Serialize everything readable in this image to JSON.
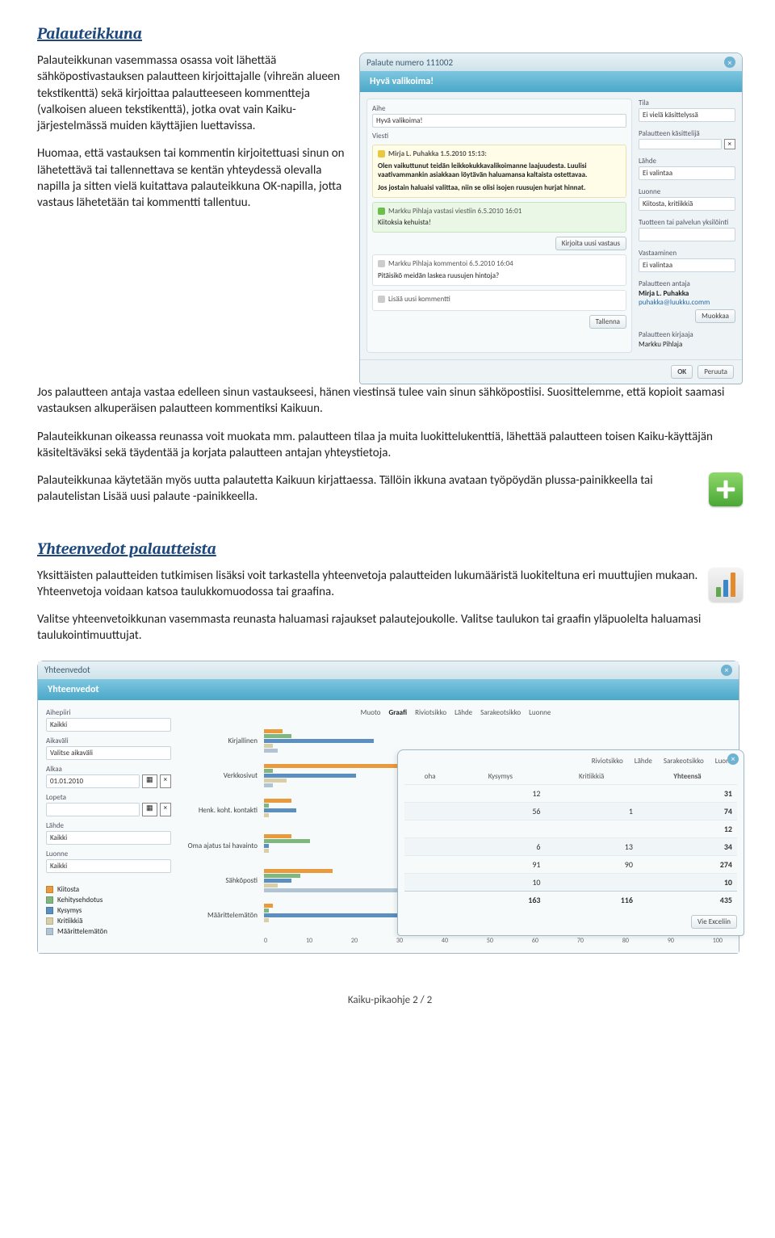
{
  "doc": {
    "h1": "Palauteikkuna",
    "p1": "Palauteikkunan vasemmassa osassa voit lähettää sähköpostivastauksen palautteen kirjoittajalle (vihreän alueen tekstikenttä) sekä kirjoittaa palautteeseen kommentteja (valkoisen alueen tekstikenttä), jotka ovat vain Kaiku-järjestelmässä muiden käyttäjien luettavissa.",
    "p2": "Huomaa, että vastauksen tai kommentin kirjoitettuasi sinun on lähetettävä tai tallennettava se kentän yhteydessä olevalla napilla ja sitten vielä kuitattava palauteikkuna OK-napilla, jotta vastaus lähetetään tai kommentti tallentuu.",
    "p3": "Jos palautteen antaja vastaa edelleen sinun vastaukseesi, hänen viestinsä tulee vain sinun sähköpostiisi. Suosittelemme, että kopioit saamasi vastauksen alkuperäisen palautteen kommentiksi Kaikuun.",
    "p4": "Palauteikkunan oikeassa reunassa voit muokata mm. palautteen tilaa ja muita luokittelukenttiä, lähettää palautteen toisen Kaiku-käyttäjän käsiteltäväksi sekä täydentää ja korjata palautteen antajan yhteystietoja.",
    "p5": "Palauteikkunaa käytetään myös uutta palautetta Kaikuun kirjattaessa. Tällöin ikkuna avataan työpöydän plussa-painikkeella tai palautelistan Lisää uusi palaute -painikkeella.",
    "h2": "Yhteenvedot palautteista",
    "p6": "Yksittäisten palautteiden tutkimisen lisäksi voit tarkastella yhteenvetoja palautteiden lukumääristä luokiteltuna eri muuttujien mukaan. Yhteenvetoja voidaan katsoa taulukkomuodossa tai graafina.",
    "p7": "Valitse yhteenvetoikkunan vasemmasta reunasta haluamasi rajaukset palautejoukolle. Valitse taulukon tai graafin yläpuolelta haluamasi taulukointimuuttujat.",
    "footer": "Kaiku-pikaohje 2 / 2"
  },
  "dlg1": {
    "title": "Palaute numero 111002",
    "tab": "Hyvä valikoima!",
    "aihe_label": "Aihe",
    "aihe_value": "Hyvä valikoima!",
    "viesti_label": "Viesti",
    "msg1_head": "Mirja L. Puhakka 1.5.2010 15:13:",
    "msg1_body": "Olen vaikuttunut teidän leikkokukkavalikoimanne laajuudesta. Luulisi vaativammankin asiakkaan löytävän haluamansa kaltaista ostettavaa.",
    "msg1_body2": "Jos jostain haluaisi valittaa, niin se olisi isojen ruusujen hurjat hinnat.",
    "msg2_head": "Markku Pihlaja vastasi viestiin 6.5.2010 16:01",
    "msg2_body": "Kiitoksia kehuista!",
    "btn_new_reply": "Kirjoita uusi vastaus",
    "msg3_head": "Markku Pihlaja kommentoi 6.5.2010 16:04",
    "msg3_body": "Pitäisikö meidän laskea ruusujen hintoja?",
    "btn_new_comment": "Lisää uusi kommentti",
    "btn_tallenna": "Tallenna",
    "btn_ok": "OK",
    "btn_peruuta": "Peruuta",
    "side": {
      "tila_l": "Tila",
      "tila_v": "Ei vielä käsittelyssä",
      "kasittelija_l": "Palautteen käsittelijä",
      "lahde_l": "Lähde",
      "lahde_v": "Ei valintaa",
      "luonne_l": "Luonne",
      "luonne_v": "Kiitosta, kritiikkiä",
      "tuotteen_l": "Tuotteen tai palvelun yksilöinti",
      "vastaaminen_l": "Vastaaminen",
      "vastaaminen_v": "Ei valintaa",
      "antaja_l": "Palautteen antaja",
      "antaja_name": "Mirja L. Puhakka",
      "antaja_email": "puhakka@luukku.comm",
      "btn_muokkaa": "Muokkaa",
      "kirjaaja_l": "Palautteen kirjaaja",
      "kirjaaja_v": "Markku Pihlaja"
    }
  },
  "dlg2": {
    "title": "Yhteenvedot",
    "tab": "Yhteenvedot",
    "left": {
      "aihepiiri_l": "Aihepiiri",
      "aihepiiri_v": "Kaikki",
      "aikavali_l": "Aikaväli",
      "aikavali_v": "Valitse aikaväli",
      "alkaa_l": "Alkaa",
      "alkaa_v": "01.01.2010",
      "lopeta_l": "Lopeta",
      "lahde_l": "Lähde",
      "lahde_v": "Kaikki",
      "luonne_l": "Luonne",
      "luonne_v": "Kaikki"
    },
    "legend": [
      {
        "label": "Kiitosta",
        "color": "#e89a3c"
      },
      {
        "label": "Kehitysehdotus",
        "color": "#7fb77e"
      },
      {
        "label": "Kysymys",
        "color": "#5a8fbf"
      },
      {
        "label": "Kritiikkiä",
        "color": "#d8cfa8"
      },
      {
        "label": "Määrittelemätön",
        "color": "#b0c4d4"
      }
    ],
    "tabs": [
      "Muoto",
      "Graafi",
      "Riviotsikko",
      "Lähde",
      "Sarakeotsikko",
      "Luonne"
    ],
    "chart_labels": [
      "Kirjallinen",
      "Verkkosivut",
      "Henk. koht. kontakti",
      "Oma ajatus tai havainto",
      "Sähköposti",
      "Määrittelemätön"
    ],
    "axis": [
      "0",
      "10",
      "20",
      "30",
      "40",
      "50",
      "60",
      "70",
      "80",
      "90",
      "100"
    ]
  },
  "chart_data": {
    "type": "bar",
    "orientation": "horizontal",
    "stacked": false,
    "categories": [
      "Kirjallinen",
      "Verkkosivut",
      "Henk. koht. kontakti",
      "Oma ajatus tai havainto",
      "Sähköposti",
      "Määrittelemätön"
    ],
    "series": [
      {
        "name": "Kiitosta",
        "color": "#e89a3c",
        "values": [
          4,
          38,
          6,
          6,
          15,
          2
        ]
      },
      {
        "name": "Kehitysehdotus",
        "color": "#7fb77e",
        "values": [
          6,
          2,
          1,
          10,
          8,
          1
        ]
      },
      {
        "name": "Kysymys",
        "color": "#5a8fbf",
        "values": [
          24,
          20,
          7,
          1,
          6,
          100
        ]
      },
      {
        "name": "Kritiikkiä",
        "color": "#d8cfa8",
        "values": [
          2,
          5,
          1,
          1,
          3,
          1
        ]
      },
      {
        "name": "Määrittelemätön",
        "color": "#b0c4d4",
        "values": [
          3,
          2,
          0,
          0,
          80,
          0
        ]
      }
    ],
    "xlim": [
      0,
      100
    ],
    "xlabel": "",
    "ylabel": ""
  },
  "overlay": {
    "headers": [
      "",
      "Riviotsikko",
      "Lähde",
      "Sarakeotsikko",
      "Luonne"
    ],
    "cols": [
      "oha",
      "Kysymys",
      "Kritiikkiä",
      "Yhteensä"
    ],
    "rows": [
      [
        "",
        "12",
        "",
        "31"
      ],
      [
        "",
        "56",
        "1",
        "74"
      ],
      [
        "",
        "",
        "",
        "12"
      ],
      [
        "",
        "6",
        "13",
        "34"
      ],
      [
        "",
        "91",
        "90",
        "274"
      ],
      [
        "",
        "10",
        "",
        "10"
      ]
    ],
    "totals": [
      "",
      "163",
      "116",
      "435"
    ],
    "btn_excel": "Vie Exceliin"
  }
}
